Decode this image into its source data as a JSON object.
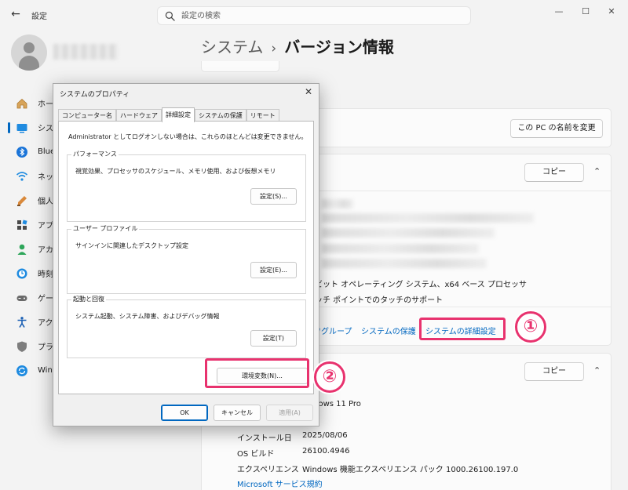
{
  "window": {
    "app_title": "設定",
    "back": "←",
    "minimize": "—",
    "maximize": "☐",
    "close": "✕"
  },
  "search": {
    "placeholder": "設定の検索"
  },
  "breadcrumb": {
    "parent": "システム",
    "sep": "›",
    "current": "バージョン情報"
  },
  "sidebar": {
    "items": [
      {
        "label": "ホーム",
        "icon": "home-icon"
      },
      {
        "label": "システム",
        "icon": "system-icon"
      },
      {
        "label": "Blue",
        "icon": "bluetooth-icon"
      },
      {
        "label": "ネッ",
        "icon": "network-icon"
      },
      {
        "label": "個人",
        "icon": "personalize-icon"
      },
      {
        "label": "アプ",
        "icon": "apps-icon"
      },
      {
        "label": "アカ",
        "icon": "account-icon"
      },
      {
        "label": "時刻",
        "icon": "time-icon"
      },
      {
        "label": "ゲー",
        "icon": "game-icon"
      },
      {
        "label": "アク",
        "icon": "accessibility-icon"
      },
      {
        "label": "プラ",
        "icon": "privacy-icon"
      },
      {
        "label": "Win",
        "icon": "windows-update-icon"
      }
    ]
  },
  "device": {
    "rename_button": "この PC の名前を変更",
    "copy_button": "コピー",
    "spec_type": "ビット オペレーティング システム、x64 ベース プロセッサ",
    "spec_touch": "ッチ ポイントでのタッチのサポート",
    "links": {
      "workgroup": "ワグループ",
      "protection": "システムの保護",
      "advanced": "システムの詳細設定"
    }
  },
  "windows_spec": {
    "copy_button": "コピー",
    "edition_value": "indows 11 Pro",
    "version_value": "2",
    "rows": [
      {
        "label": "インストール日",
        "value": "2025/08/06"
      },
      {
        "label": "OS ビルド",
        "value": "26100.4946"
      },
      {
        "label": "エクスペリエンス",
        "value": "Windows 機能エクスペリエンス パック 1000.26100.197.0"
      }
    ],
    "link_services": "Microsoft サービス規約"
  },
  "annotations": {
    "badge1": "①",
    "badge2": "②",
    "accent": "#e8326e"
  },
  "dialog": {
    "title": "システムのプロパティ",
    "close": "✕",
    "tabs": [
      "コンピューター名",
      "ハードウェア",
      "詳細設定",
      "システムの保護",
      "リモート"
    ],
    "admin_note": "Administrator としてログオンしない場合は、これらのほとんどは変更できません。",
    "performance": {
      "title": "パフォーマンス",
      "desc": "視覚効果、プロセッサのスケジュール、メモリ使用、および仮想メモリ",
      "button": "設定(S)..."
    },
    "profile": {
      "title": "ユーザー プロファイル",
      "desc": "サインインに関連したデスクトップ設定",
      "button": "設定(E)..."
    },
    "startup": {
      "title": "起動と回復",
      "desc": "システム起動、システム障害、およびデバッグ情報",
      "button": "設定(T)"
    },
    "env_button": "環境変数(N)...",
    "ok": "OK",
    "cancel": "キャンセル",
    "apply": "適用(A)"
  }
}
